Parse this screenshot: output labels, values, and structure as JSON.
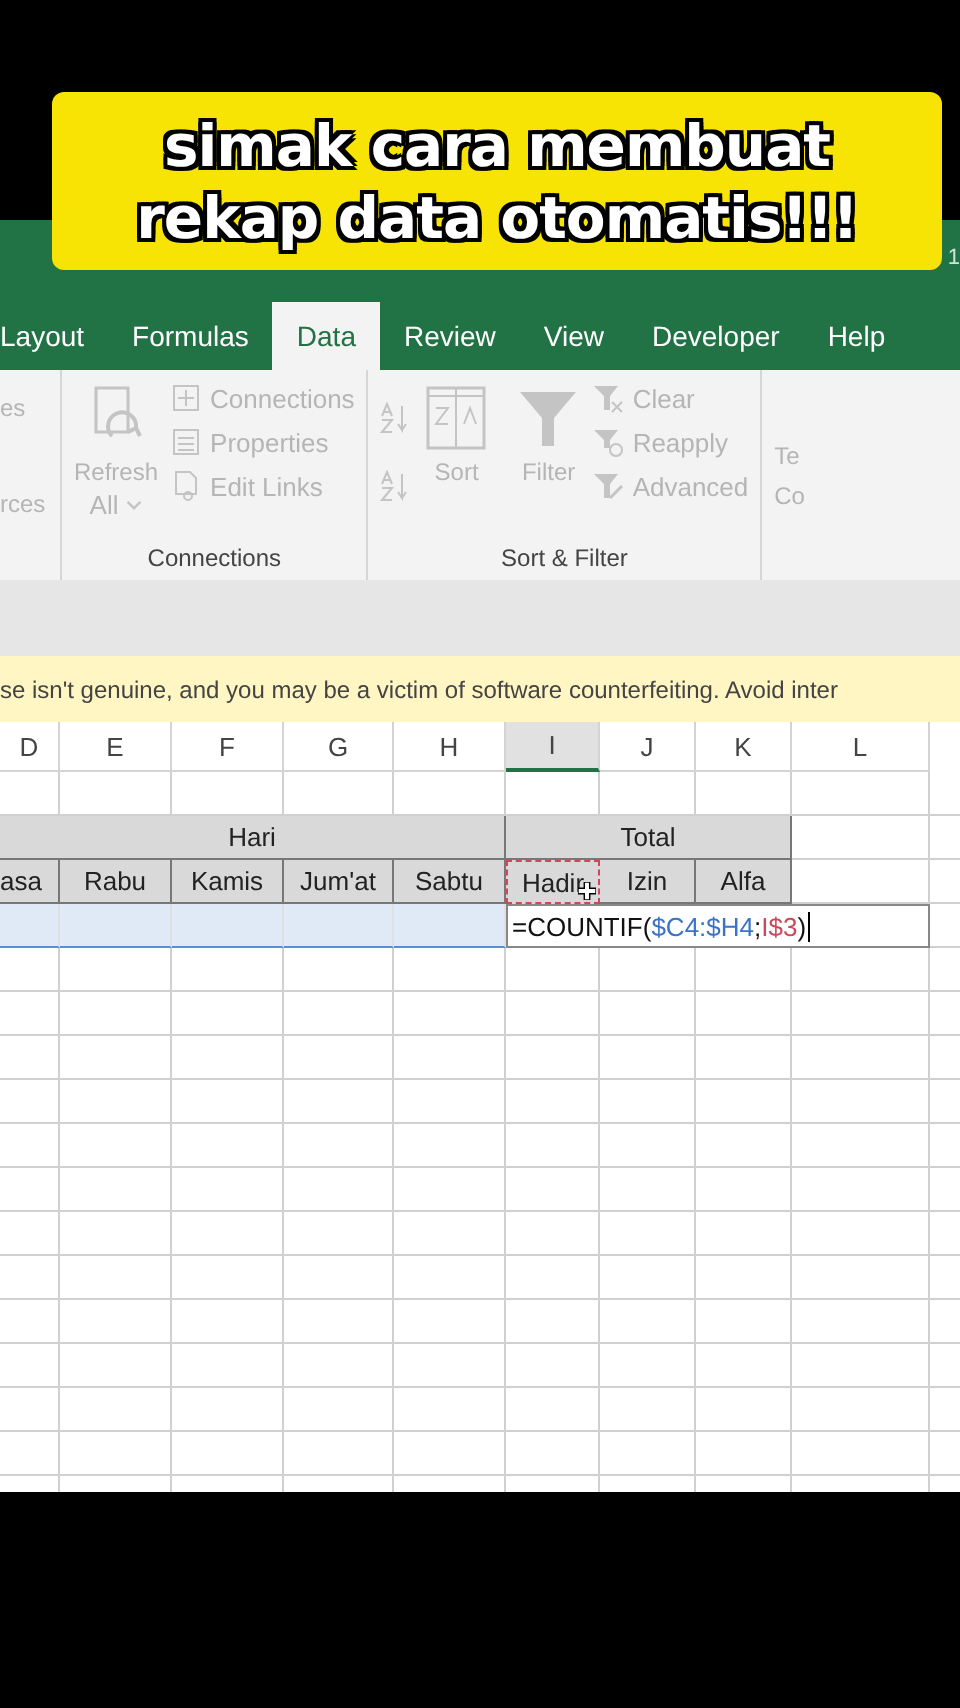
{
  "caption": "simak cara membuat\nrekap data otomatis!!!",
  "title_fragment": "1",
  "tabs": [
    {
      "label": "Layout",
      "selected": false
    },
    {
      "label": "Formulas",
      "selected": false
    },
    {
      "label": "Data",
      "selected": true
    },
    {
      "label": "Review",
      "selected": false
    },
    {
      "label": "View",
      "selected": false
    },
    {
      "label": "Developer",
      "selected": false
    },
    {
      "label": "Help",
      "selected": false
    }
  ],
  "ribbon": {
    "disabled": true,
    "left_fragments": [
      "es",
      "rces"
    ],
    "connections": {
      "refresh": "Refresh",
      "refresh_2": "All",
      "commands": [
        "Connections",
        "Properties",
        "Edit Links"
      ],
      "group_label": "Connections"
    },
    "sort_filter": {
      "sort": "Sort",
      "filter": "Filter",
      "commands": [
        "Clear",
        "Reapply",
        "Advanced"
      ],
      "group_label": "Sort & Filter"
    },
    "right_fragments": [
      "Te",
      "Co"
    ]
  },
  "warning": "se isn't genuine, and you may be a victim of software counterfeiting. Avoid inter",
  "columns": [
    {
      "label": "D",
      "selected": false
    },
    {
      "label": "E",
      "selected": false
    },
    {
      "label": "F",
      "selected": false
    },
    {
      "label": "G",
      "selected": false
    },
    {
      "label": "H",
      "selected": false
    },
    {
      "label": "I",
      "selected": true
    },
    {
      "label": "J",
      "selected": false
    },
    {
      "label": "K",
      "selected": false
    },
    {
      "label": "L",
      "selected": false
    }
  ],
  "group_headers": [
    "Hari",
    "Total"
  ],
  "subheaders": [
    {
      "label": "asa",
      "referenced": false
    },
    {
      "label": "Rabu",
      "referenced": false
    },
    {
      "label": "Kamis",
      "referenced": false
    },
    {
      "label": "Jum'at",
      "referenced": false
    },
    {
      "label": "Sabtu",
      "referenced": false
    },
    {
      "label": "Hadir",
      "referenced": true
    },
    {
      "label": "Izin",
      "referenced": false
    },
    {
      "label": "Alfa",
      "referenced": false
    }
  ],
  "editing_row": {
    "range_highlighted": true,
    "formula": [
      {
        "text": "=COUNTIF(",
        "color": "#111111"
      },
      {
        "text": "$C4:$H4",
        "color": "#3b73c6"
      },
      {
        "text": ";",
        "color": "#111111"
      },
      {
        "text": "I$3",
        "color": "#c94a5a"
      },
      {
        "text": ")",
        "color": "#111111"
      }
    ]
  }
}
